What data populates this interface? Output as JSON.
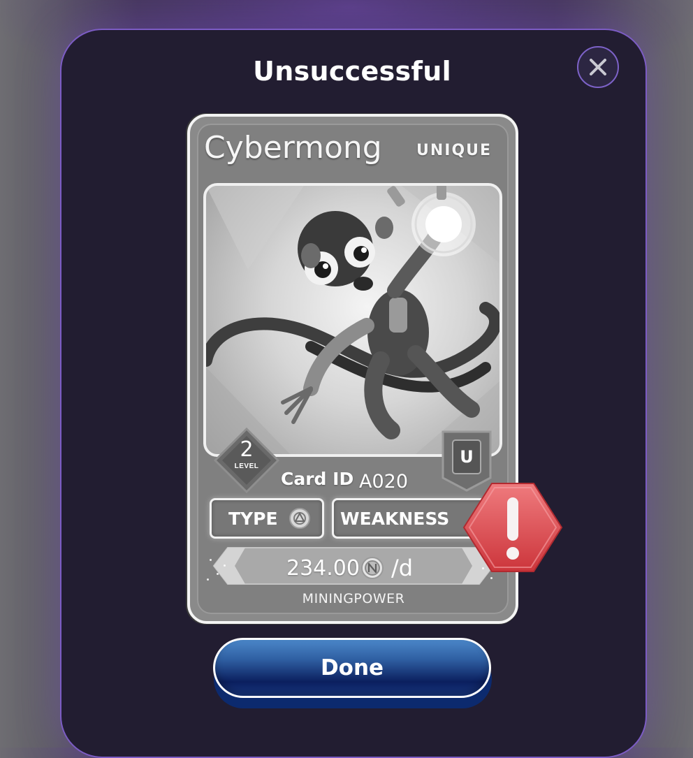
{
  "modal": {
    "title": "Unsuccessful",
    "close_icon": "close-icon"
  },
  "card": {
    "name": "Cybermong",
    "rarity": "UNIQUE",
    "rarity_badge": "U",
    "level": "2",
    "level_label": "LEVEL",
    "card_id_label": "Card ID",
    "card_id": "A020",
    "type_label": "TYPE",
    "type_icon": "arc-reactor-icon",
    "weakness_label": "WEAKNESS",
    "mining_power_value": "234.00",
    "mining_power_unit": "/d",
    "mining_power_label": "MININGPOWER",
    "coin_icon": "coin-icon"
  },
  "alert": {
    "icon": "warning-octagon-icon",
    "color": "#e0464b"
  },
  "actions": {
    "done_label": "Done"
  },
  "colors": {
    "modal_border": "#7c5cc4",
    "modal_bg": "#221d31",
    "button_blue": "#2f5fa2"
  }
}
